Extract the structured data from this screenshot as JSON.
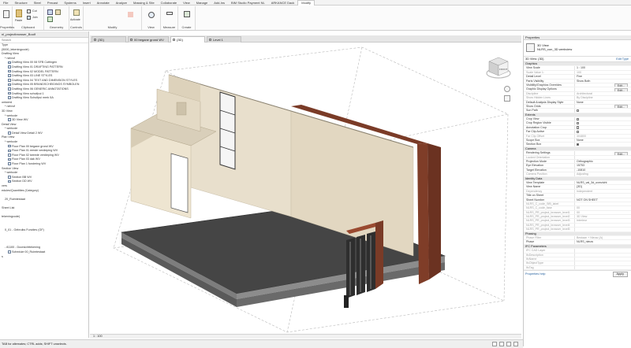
{
  "ribbon": {
    "tabs": [
      "File",
      "Structure",
      "Steel",
      "Precast",
      "Systems",
      "Insert",
      "Annotate",
      "Analyze",
      "Massing & Site",
      "Collaborate",
      "View",
      "Manage",
      "Add-Ins",
      "BIM Studio Payment NL",
      "ARKANCE Dack",
      "Modify"
    ],
    "active_tab": "Modify",
    "groups": [
      {
        "label": "Properties"
      },
      {
        "label": "Clipboard",
        "items": [
          "Paste",
          "Cut",
          "Join"
        ]
      },
      {
        "label": "Geometry"
      },
      {
        "label": "Controls",
        "items": [
          "Activate"
        ]
      },
      {
        "label": "Modify"
      },
      {
        "label": "View"
      },
      {
        "label": "Measure"
      },
      {
        "label": "Create"
      }
    ]
  },
  "browser": {
    "title": "nl_projectbrowser_Boolf",
    "search_placeholder": "Search",
    "items": [
      {
        "label": "Type",
        "indent": 0
      },
      {
        "label": "(5000_tekeningcode)",
        "indent": 0
      },
      {
        "label": "Drafting View",
        "indent": 0
      },
      {
        "label": "* nebrof",
        "indent": 1
      },
      {
        "label": "Drafting View 00 08 SFB Cuttingen",
        "indent": 2
      },
      {
        "label": "Drafting View 01 DRAFTING PATTERN",
        "indent": 2
      },
      {
        "label": "Drafting View 02 MODEL PATTERN",
        "indent": 2
      },
      {
        "label": "Drafting View 03 LINE STYLES",
        "indent": 2
      },
      {
        "label": "Drafting View 04 TEXT AND DIMENSION STYLES",
        "indent": 2
      },
      {
        "label": "Drafting View 05 BRANDSCHEIDINGS SYMBOLEN",
        "indent": 2
      },
      {
        "label": "Drafting View 06 GENERIC ANNOTATIONS",
        "indent": 2
      },
      {
        "label": "Drafting View schuifpui 1",
        "indent": 2
      },
      {
        "label": "Drafting View Schuifpui merk 5A",
        "indent": 2
      },
      {
        "label": "ontwerd",
        "indent": 0
      },
      {
        "label": "* nebrof",
        "indent": 1
      },
      {
        "label": "3D View",
        "indent": 0
      },
      {
        "label": "* werkcde",
        "indent": 1
      },
      {
        "label": "3D View WV",
        "indent": 2
      },
      {
        "label": "Detail View",
        "indent": 0
      },
      {
        "label": "* werkcde",
        "indent": 1
      },
      {
        "label": "Detail View Detail 2 WV",
        "indent": 2
      },
      {
        "label": "Plan View",
        "indent": 0
      },
      {
        "label": "* werkcde",
        "indent": 1
      },
      {
        "label": "Floor Plan 00 begane grond WV",
        "indent": 2
      },
      {
        "label": "Floor Plan 01 eerste verdieping WV",
        "indent": 2
      },
      {
        "label": "Floor Plan 02 tweede verdieping WV",
        "indent": 2
      },
      {
        "label": "Floor Plan 03 dak WV",
        "indent": 2
      },
      {
        "label": "Floor Plan 1 fundering WV",
        "indent": 2
      },
      {
        "label": "Section View",
        "indent": 0
      },
      {
        "label": "* werkcde",
        "indent": 1
      },
      {
        "label": "Section BB WV",
        "indent": 2
      },
      {
        "label": "Section DD WV",
        "indent": 2
      },
      {
        "label": "vers",
        "indent": 0
      },
      {
        "label": "edules/Quantities (Category)",
        "indent": 0
      },
      {
        "label": "",
        "indent": 0
      },
      {
        "label": "20_Ruimtestaat",
        "indent": 1
      },
      {
        "label": "",
        "indent": 0
      },
      {
        "label": "Sheet List",
        "indent": 0
      },
      {
        "label": "",
        "indent": 0
      },
      {
        "label": "tekeningcode)",
        "indent": 0
      },
      {
        "label": "",
        "indent": 0
      },
      {
        "label": "",
        "indent": 0
      },
      {
        "label": "0_01 - Gebruiks Functies (GF)",
        "indent": 1
      },
      {
        "label": "",
        "indent": 0
      },
      {
        "label": "",
        "indent": 0
      },
      {
        "label": "",
        "indent": 0
      },
      {
        "label": "- 81100 - Doorsichttekening",
        "indent": 1
      },
      {
        "label": "Schedule 00_Ruimtestaat",
        "indent": 2
      },
      {
        "label": "s",
        "indent": 0
      }
    ]
  },
  "view_tabs": [
    {
      "label": "{3D}",
      "active": false
    },
    {
      "label": "00 begane grond WV",
      "active": false
    },
    {
      "label": "{3D}",
      "active": true
    },
    {
      "label": "Level 1",
      "active": false
    }
  ],
  "view_controls": {
    "scale": "1 : 100"
  },
  "viewcube": {
    "face": "FRONT"
  },
  "properties": {
    "title": "Properties",
    "type_name": "3D View",
    "type_subname": "NLRS_con_3D werkview",
    "filter_label": "3D View: {3D}",
    "edit_type": "Edit Type",
    "groups": [
      {
        "name": "Graphics",
        "rows": [
          {
            "n": "View Scale",
            "v": "1 : 100",
            "grey": false
          },
          {
            "n": "Scale Value 1:",
            "v": "100",
            "grey": true
          },
          {
            "n": "Detail Level",
            "v": "Fine",
            "grey": false
          },
          {
            "n": "Parts Visibility",
            "v": "Show Both",
            "grey": false
          },
          {
            "n": "Visibility/Graphics Overrides",
            "v": "Edit...",
            "grey": false,
            "button": true
          },
          {
            "n": "Graphic Display Options",
            "v": "Edit...",
            "grey": false,
            "button": true
          },
          {
            "n": "Discipline",
            "v": "Architectural",
            "grey": true
          },
          {
            "n": "Show Hidden Lines",
            "v": "By Discipline",
            "grey": true
          },
          {
            "n": "Default Analysis Display Style",
            "v": "None",
            "grey": false
          },
          {
            "n": "Show Grids",
            "v": "Edit...",
            "grey": false,
            "button": true
          },
          {
            "n": "Sun Path",
            "v": "",
            "grey": false,
            "check": false
          }
        ]
      },
      {
        "name": "Extents",
        "rows": [
          {
            "n": "Crop View",
            "v": "",
            "grey": false,
            "check": false
          },
          {
            "n": "Crop Region Visible",
            "v": "",
            "grey": false,
            "check": false
          },
          {
            "n": "Annotation Crop",
            "v": "",
            "grey": false,
            "check": false
          },
          {
            "n": "Far Clip Active",
            "v": "",
            "grey": false,
            "check": false
          },
          {
            "n": "Far Clip Offset",
            "v": "304800",
            "grey": true
          },
          {
            "n": "Scope Box",
            "v": "None",
            "grey": false
          },
          {
            "n": "Section Box",
            "v": "",
            "grey": false,
            "check": true
          }
        ]
      },
      {
        "name": "Camera",
        "rows": [
          {
            "n": "Rendering Settings",
            "v": "Edit...",
            "grey": false,
            "button": true
          },
          {
            "n": "Locked Orientation",
            "v": "",
            "grey": true
          },
          {
            "n": "Projection Mode",
            "v": "Orthographic",
            "grey": false
          },
          {
            "n": "Eye Elevation",
            "v": "15753",
            "grey": false
          },
          {
            "n": "Target Elevation",
            "v": "-10810",
            "grey": false
          },
          {
            "n": "Camera Position",
            "v": "Adjusting",
            "grey": true
          }
        ]
      },
      {
        "name": "Identity Data",
        "rows": [
          {
            "n": "View Template",
            "v": "NLRS_val_3d_overzicht",
            "grey": false
          },
          {
            "n": "View Name",
            "v": "{3D}",
            "grey": false
          },
          {
            "n": "Dependency",
            "v": "Independent",
            "grey": true
          },
          {
            "n": "Title on Sheet",
            "v": "",
            "grey": false
          },
          {
            "n": "Sheet Number",
            "v": "NOT ON SHEET",
            "grey": false
          },
          {
            "n": "NLRS_C_code_SfB_label",
            "v": "",
            "grey": true
          },
          {
            "n": "NLRS_C_code_fase",
            "v": "00",
            "grey": true
          },
          {
            "n": "NLRS_PR_project_browser_level1",
            "v": "00",
            "grey": true
          },
          {
            "n": "NLRS_PR_project_browser_level2",
            "v": "3D View",
            "grey": true
          },
          {
            "n": "NLRS_PR_project_browser_level3",
            "v": "Interieur",
            "grey": true
          },
          {
            "n": "NLRS_PR_project_browser_level4",
            "v": "",
            "grey": true
          },
          {
            "n": "NLRS_PR_project_browser_level5",
            "v": "",
            "grey": true
          }
        ]
      },
      {
        "name": "Phasing",
        "rows": [
          {
            "n": "Phase Filter",
            "v": "Bestaan + Nieuw (A)",
            "grey": true
          },
          {
            "n": "Phase",
            "v": "NLRS_nieuw",
            "grey": false
          }
        ]
      },
      {
        "name": "IFC Parameters",
        "rows": [
          {
            "n": "IFC CAD Layer",
            "v": "",
            "grey": true
          },
          {
            "n": "IfcDescription",
            "v": "",
            "grey": true
          },
          {
            "n": "IfcName",
            "v": "",
            "grey": true
          },
          {
            "n": "IfcObjectType",
            "v": "",
            "grey": true
          },
          {
            "n": "IfcTag",
            "v": "",
            "grey": true
          }
        ]
      }
    ],
    "help_link": "Properties help",
    "apply_button": "Apply"
  },
  "statusbar": {
    "text": "TAB for alternates; CTRL adds; SHIFT unselects."
  },
  "colors": {
    "brick": "#7a3b27",
    "wall": "#e8dfcc",
    "floor": "#3e3e3e",
    "accent": "#225f9e"
  }
}
